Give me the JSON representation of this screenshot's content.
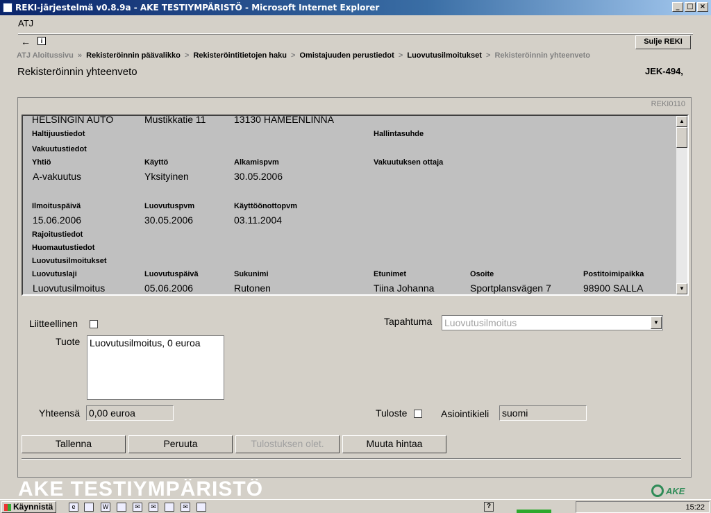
{
  "window": {
    "title": "REKI-järjestelmä v0.8.9a - AKE TESTIYMPÄRISTÖ - Microsoft Internet Explorer",
    "minimize": "_",
    "maximize": "□",
    "close": "×"
  },
  "app": {
    "atj_label": "ATJ",
    "back_icon": "←",
    "info_icon": "i",
    "close_button": "Sulje REKI"
  },
  "breadcrumb": [
    {
      "label": "ATJ Aloitussivu",
      "current": false
    },
    {
      "label": "Rekisteröinnin päävalikko",
      "current": false
    },
    {
      "label": "Rekisteröintitietojen haku",
      "current": false
    },
    {
      "label": "Omistajuuden perustiedot",
      "current": false
    },
    {
      "label": "Luovutusilmoitukset",
      "current": false
    },
    {
      "label": "Rekisteröinnin yhteenveto",
      "current": true
    }
  ],
  "breadcrumb_separator": "»",
  "breadcrumb_separator2": ">",
  "page": {
    "title": "Rekisteröinnin yhteenveto",
    "plate": "JEK-494,",
    "form_code": "REKI0110"
  },
  "summary": {
    "owner_name": "HELSINGIN AUTO",
    "owner_address": "Mustikkatie 11",
    "owner_postal": "13130 HAMEENLINNA",
    "haltijuustiedot_label": "Haltijuustiedot",
    "hallintasuhde_label": "Hallintasuhde",
    "vakuutustiedot_label": "Vakuutustiedot",
    "insurance_headers": {
      "yhtio": "Yhtiö",
      "kaytto": "Käyttö",
      "alkamispvm": "Alkamispvm",
      "vakuutuksen_ottaja": "Vakuutuksen ottaja"
    },
    "insurance_values": {
      "yhtio": "A-vakuutus",
      "kaytto": "Yksityinen",
      "alkamispvm": "30.05.2006"
    },
    "dates_headers": {
      "ilmoituspaiva": "Ilmoituspäivä",
      "luovutuspvm": "Luovutuspvm",
      "kayttoonottopvm": "Käyttöönottopvm"
    },
    "dates_values": {
      "ilmoituspaiva": "15.06.2006",
      "luovutuspvm": "30.05.2006",
      "kayttoonottopvm": "03.11.2004"
    },
    "rajoitustiedot_label": "Rajoitustiedot",
    "huomautustiedot_label": "Huomautustiedot",
    "luovutusilmoitukset_label": "Luovutusilmoitukset",
    "transfer_headers": {
      "luovutuslaji": "Luovutuslaji",
      "luovutuspaiva": "Luovutuspäivä",
      "sukunimi": "Sukunimi",
      "etunimet": "Etunimet",
      "osoite": "Osoite",
      "postitoimipaikka": "Postitoimipaikka"
    },
    "transfer_values": {
      "luovutuslaji": "Luovutusilmoitus",
      "luovutuspaiva": "05.06.2006",
      "sukunimi": "Rutonen",
      "etunimet": "Tiina Johanna",
      "osoite": "Sportplansvägen 7",
      "postitoimipaikka": "98900 SALLA"
    }
  },
  "form": {
    "liitteellinen_label": "Liitteellinen",
    "liitteellinen_checked": false,
    "tapahtuma_label": "Tapahtuma",
    "tapahtuma_value": "Luovutusilmoitus",
    "tuote_label": "Tuote",
    "tuote_value": "Luovutusilmoitus, 0 euroa",
    "yhteensa_label": "Yhteensä",
    "yhteensa_value": "0,00 euroa",
    "tuloste_label": "Tuloste",
    "tuloste_checked": false,
    "asiointikieli_label": "Asiointikieli",
    "asiointikieli_value": "suomi"
  },
  "buttons": {
    "tallenna": "Tallenna",
    "peruuta": "Peruuta",
    "tulostuksen_olet": "Tulostuksen olet.",
    "muuta_hintaa": "Muuta hintaa"
  },
  "footer": {
    "environment_banner": "AKE TESTIYMPÄRISTÖ",
    "logo_text": "AKE"
  },
  "taskbar": {
    "start_label": "Käynnistä",
    "help_icon": "?",
    "clock": "15:22"
  }
}
